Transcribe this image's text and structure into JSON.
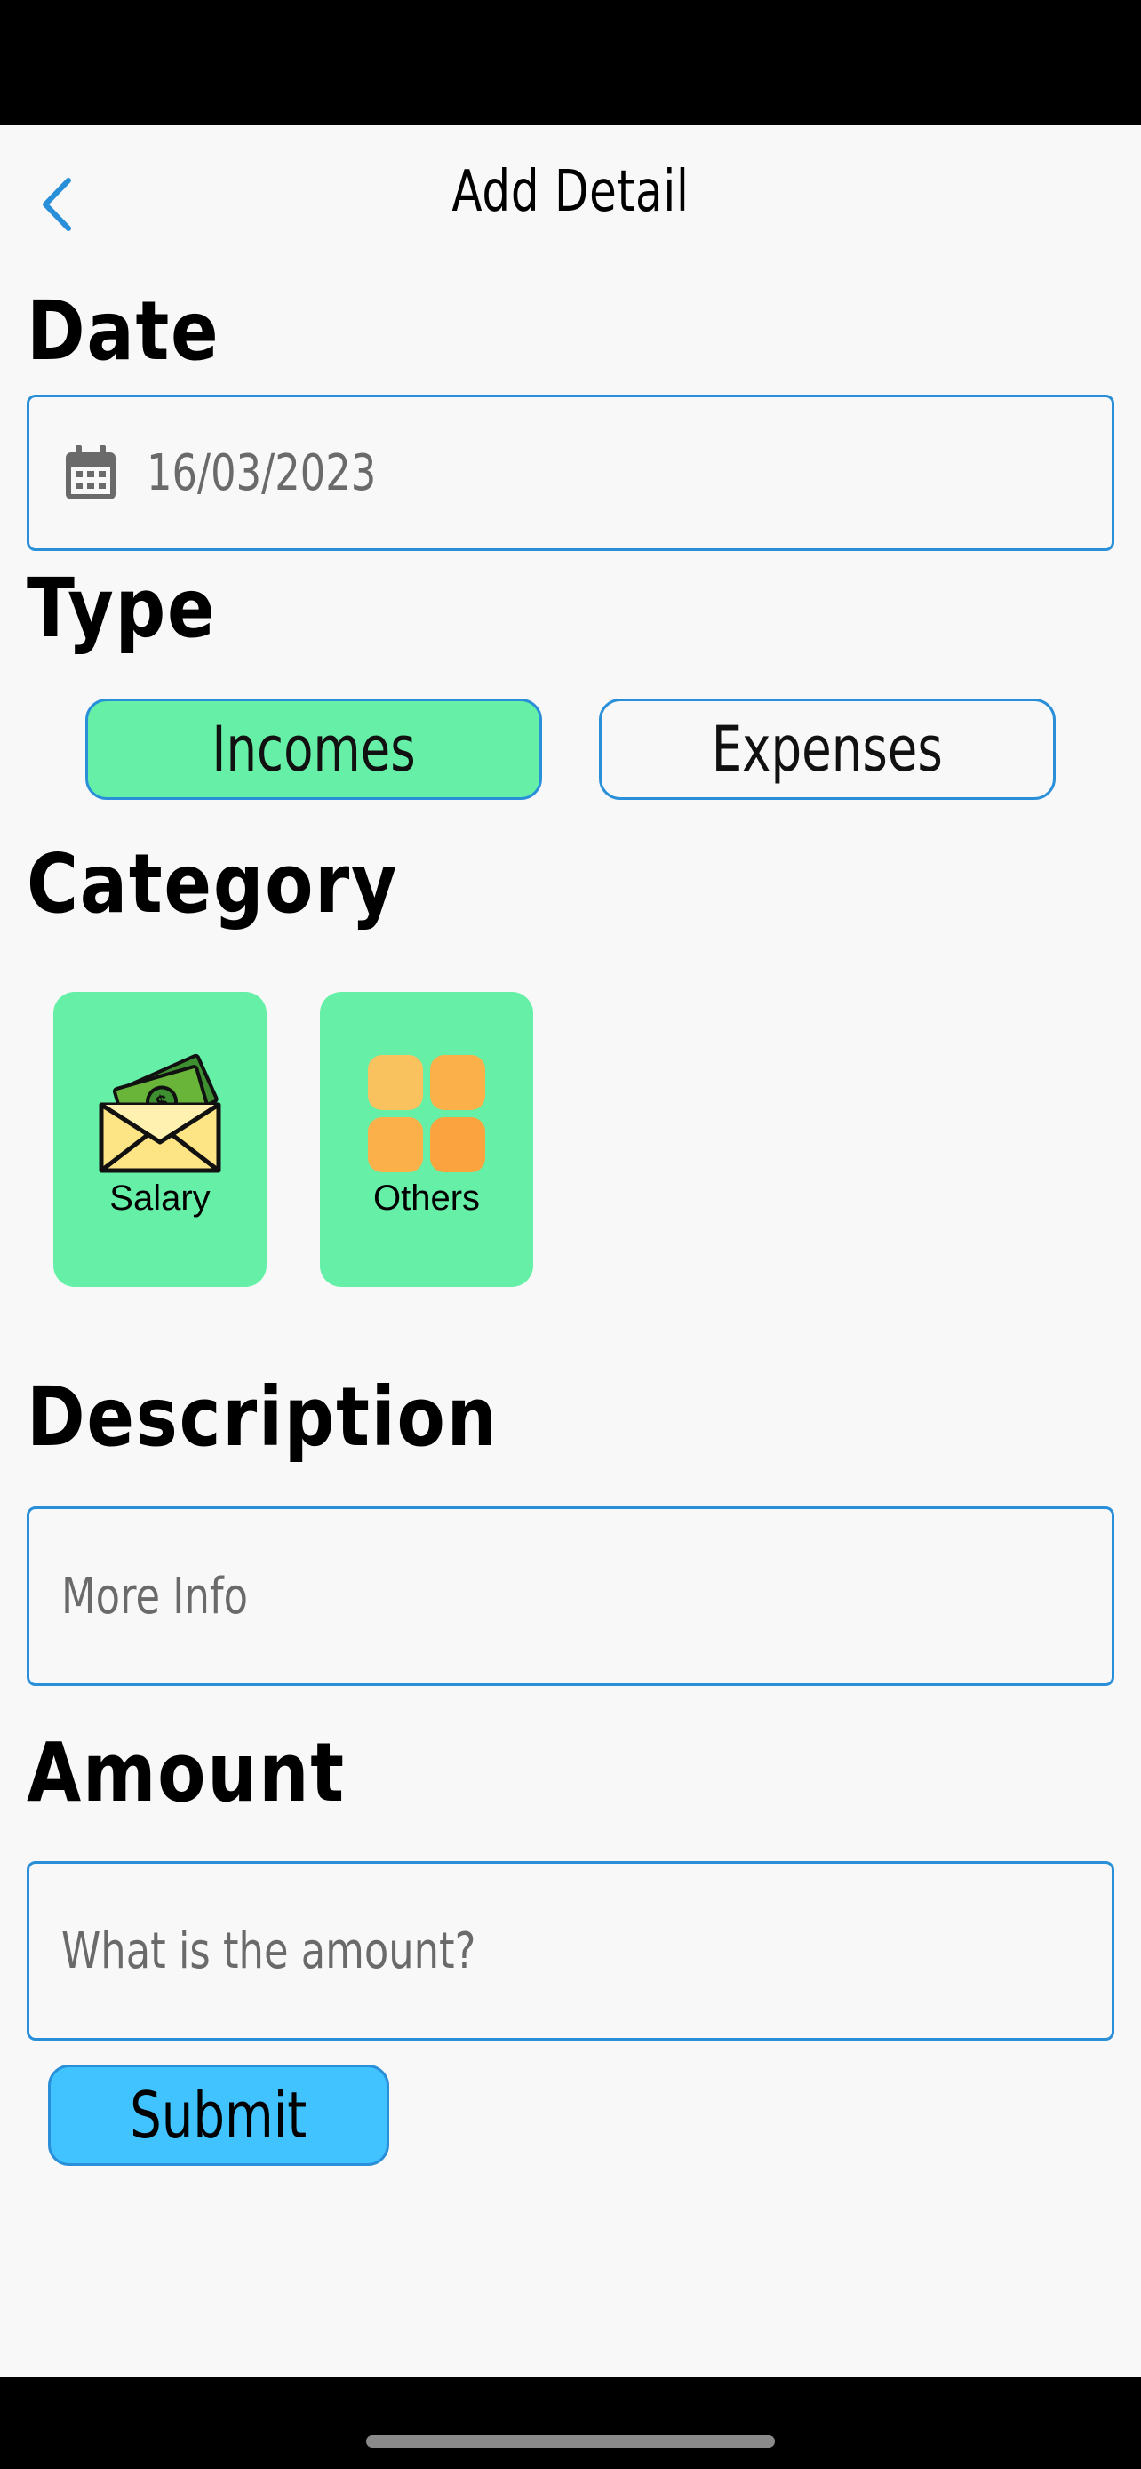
{
  "header": {
    "title": "Add Detail",
    "back_icon": "chevron-left-icon"
  },
  "date": {
    "label": "Date",
    "value": "16/03/2023",
    "icon": "calendar-icon"
  },
  "type": {
    "label": "Type",
    "options": [
      {
        "label": "Incomes",
        "selected": true
      },
      {
        "label": "Expenses",
        "selected": false
      }
    ]
  },
  "category": {
    "label": "Category",
    "items": [
      {
        "label": "Salary",
        "icon": "money-envelope-icon"
      },
      {
        "label": "Others",
        "icon": "grid-icon"
      }
    ]
  },
  "description": {
    "label": "Description",
    "placeholder": "More Info"
  },
  "amount": {
    "label": "Amount",
    "placeholder": "What is the amount?"
  },
  "submit": {
    "label": "Submit"
  },
  "colors": {
    "accent": "#2a8fd9",
    "selected_fill": "#66f0a7",
    "submit_fill": "#40c3ff",
    "background": "#f8f8f8"
  }
}
